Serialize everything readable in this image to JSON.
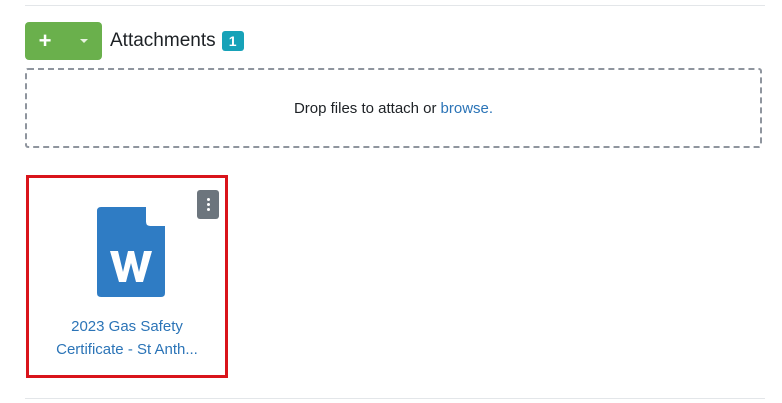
{
  "header": {
    "add_label": "+",
    "title": "Attachments",
    "count": "1"
  },
  "dropzone": {
    "text": "Drop files to attach or",
    "browse_label": "browse."
  },
  "files": [
    {
      "icon": "word-document-icon",
      "name_line1": "2023 Gas Safety",
      "name_line2": "Certificate - St Anth..."
    }
  ],
  "colors": {
    "add_button": "#6ab04c",
    "badge": "#17a2b8",
    "link": "#2b74b7",
    "selection_border": "#d9141b",
    "word_icon": "#2f7cc4",
    "kebab_button": "#6c757d"
  }
}
